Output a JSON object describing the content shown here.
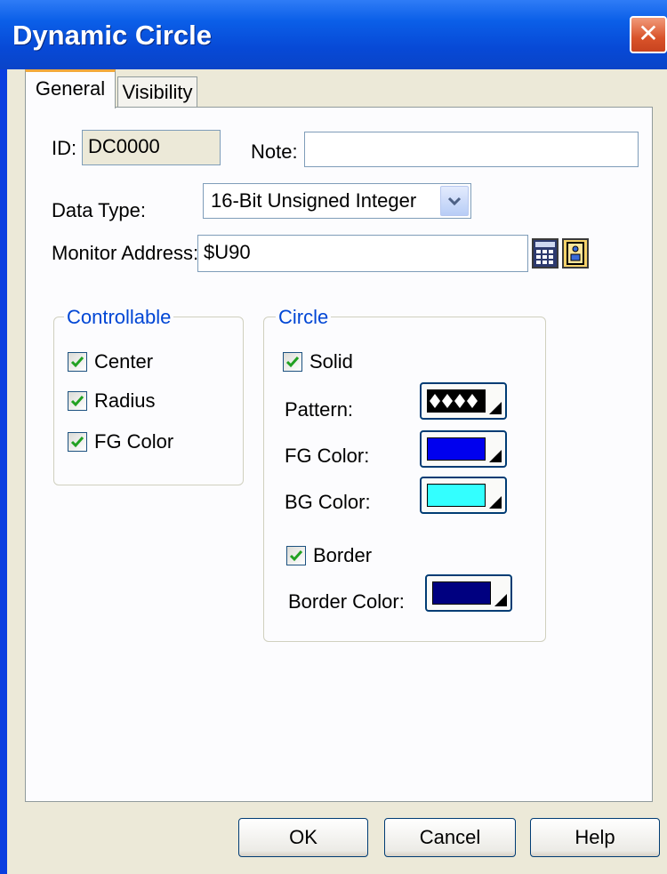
{
  "window": {
    "title": "Dynamic Circle",
    "close_glyph": "✕"
  },
  "tabs": [
    {
      "label": "General",
      "active": true
    },
    {
      "label": "Visibility",
      "active": false
    }
  ],
  "general": {
    "id_label": "ID:",
    "id_value": "DC0000",
    "note_label": "Note:",
    "note_value": "",
    "data_type_label": "Data Type:",
    "data_type_value": "16-Bit Unsigned Integer",
    "monitor_address_label": "Monitor Address:",
    "monitor_address_value": "$U90"
  },
  "controllable": {
    "title": "Controllable",
    "items": [
      {
        "label": "Center",
        "checked": true
      },
      {
        "label": "Radius",
        "checked": true
      },
      {
        "label": "FG Color",
        "checked": true
      }
    ]
  },
  "circle": {
    "title": "Circle",
    "solid": {
      "label": "Solid",
      "checked": true
    },
    "pattern_label": "Pattern:",
    "fg_color_label": "FG Color:",
    "fg_color": "#0000ee",
    "bg_color_label": "BG Color:",
    "bg_color": "#33ffff",
    "border": {
      "label": "Border",
      "checked": true
    },
    "border_color_label": "Border Color:",
    "border_color": "#000080"
  },
  "buttons": {
    "ok": "OK",
    "cancel": "Cancel",
    "help": "Help"
  },
  "icons": {
    "calculator": "calculator-icon",
    "tag": "tag-browse-icon"
  }
}
